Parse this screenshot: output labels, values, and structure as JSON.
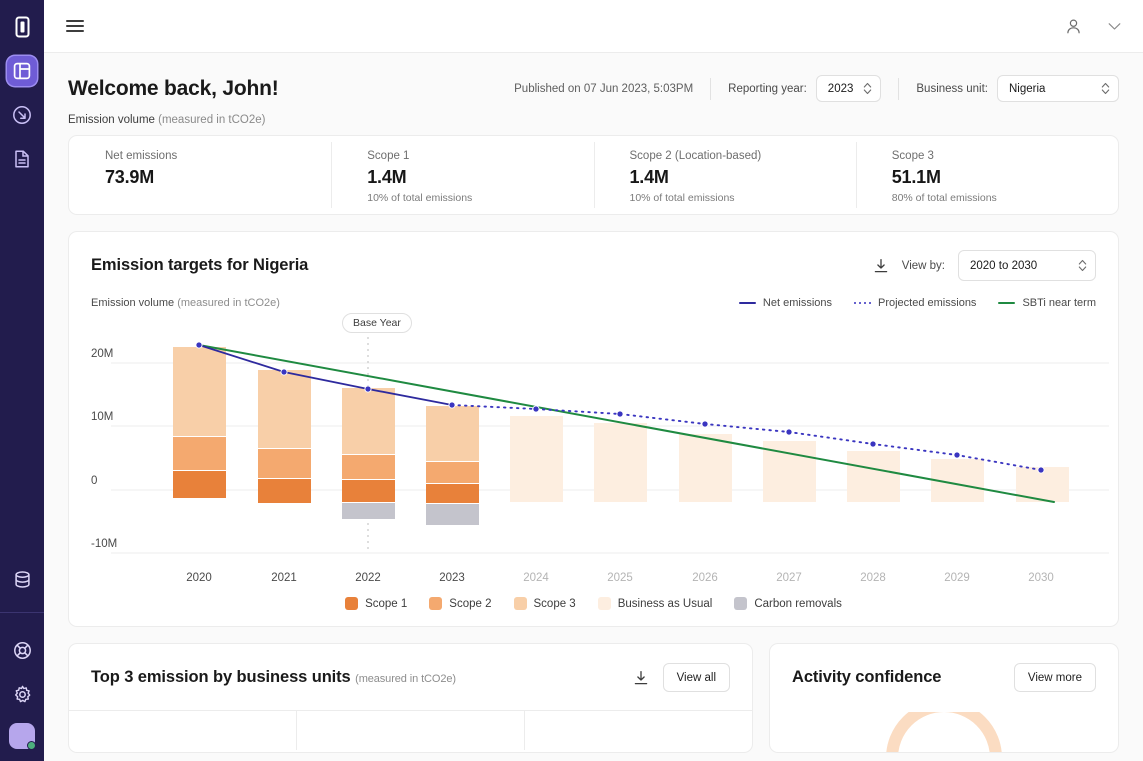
{
  "sidebar": {
    "items": [
      {
        "name": "logo-icon",
        "label": "Logo"
      },
      {
        "name": "dashboard-icon",
        "label": "Dashboard",
        "active": true
      },
      {
        "name": "data-import-icon",
        "label": "Data import"
      },
      {
        "name": "reports-icon",
        "label": "Reports"
      },
      {
        "name": "database-icon",
        "label": "Database"
      },
      {
        "name": "help-icon",
        "label": "Help"
      },
      {
        "name": "settings-icon",
        "label": "Settings"
      }
    ],
    "avatar": {
      "name": "avatar",
      "status": "online"
    }
  },
  "topbar": {
    "menu_icon": "hamburger-icon",
    "account_icon": "user-icon",
    "chevron_icon": "chevron-down-icon"
  },
  "header": {
    "title": "Welcome back, John!",
    "published": "Published on 07 Jun 2023, 5:03PM",
    "reporting_year_label": "Reporting year:",
    "reporting_year_value": "2023",
    "business_unit_label": "Business unit:",
    "business_unit_value": "Nigeria"
  },
  "emission_caption": {
    "strong": "Emission volume",
    "muted": "(measured in tCO2e)"
  },
  "kpis": [
    {
      "label": "Net emissions",
      "value": "73.9M",
      "sub": ""
    },
    {
      "label": "Scope 1",
      "value": "1.4M",
      "sub": "10% of total emissions"
    },
    {
      "label": "Scope 2 (Location-based)",
      "value": "1.4M",
      "sub": "10% of total emissions"
    },
    {
      "label": "Scope 3",
      "value": "51.1M",
      "sub": "80% of total emissions"
    }
  ],
  "chart_card": {
    "title": "Emission targets for Nigeria",
    "download_icon": "download-icon",
    "view_by_label": "View by:",
    "view_by_value": "2020 to 2030",
    "subtitle_strong": "Emission volume",
    "subtitle_muted": "(measured in tCO2e)",
    "base_year_badge": "Base Year"
  },
  "bottom": {
    "left": {
      "title": "Top 3 emission by business units",
      "title_muted": "(measured in tCO2e)",
      "download_icon": "download-icon",
      "view_all_label": "View all"
    },
    "right": {
      "title": "Activity confidence",
      "view_more_label": "View more"
    }
  },
  "colors": {
    "scope1": "#e8813a",
    "scope2": "#f4a96f",
    "scope3": "#f8cfa8",
    "bau": "#fdeee0",
    "carbon_removals": "#c4c4cc",
    "net_emissions_line": "#2e2a9e",
    "projected_line": "#3a35c0",
    "sbti_line": "#1f8a41",
    "brand_purple": "#6f5cd6",
    "sidebar_bg": "#221c4d"
  },
  "chart_data": {
    "type": "bar",
    "title": "Emission targets for Nigeria",
    "subtitle": "Emission volume (measured in tCO2e)",
    "xlabel": "",
    "ylabel": "Emission volume (tCO2e)",
    "ylim": [
      -12000000,
      23000000
    ],
    "yticks": [
      20000000,
      10000000,
      0,
      -10000000
    ],
    "ytick_labels": [
      "20M",
      "10M",
      "0",
      "-10M"
    ],
    "grid": true,
    "legend_position": "bottom",
    "categories": [
      "2020",
      "2021",
      "2022",
      "2023",
      "2024",
      "2025",
      "2026",
      "2027",
      "2028",
      "2029",
      "2030"
    ],
    "actual_years": [
      "2020",
      "2021",
      "2022",
      "2023"
    ],
    "projected_years": [
      "2024",
      "2025",
      "2026",
      "2027",
      "2028",
      "2029",
      "2030"
    ],
    "base_year": "2022",
    "stacked_series": [
      {
        "name": "Scope 1",
        "color": "#e8813a",
        "values": [
          4200000,
          3700000,
          2700000,
          2500000,
          null,
          null,
          null,
          null,
          null,
          null,
          null
        ]
      },
      {
        "name": "Scope 2",
        "color": "#f4a96f",
        "values": [
          3000000,
          2700000,
          2000000,
          1900000,
          null,
          null,
          null,
          null,
          null,
          null,
          null
        ]
      },
      {
        "name": "Scope 3",
        "color": "#f8cfa8",
        "values": [
          14000000,
          12500000,
          11000000,
          9400000,
          null,
          null,
          null,
          null,
          null,
          null,
          null
        ]
      },
      {
        "name": "Carbon removals",
        "color": "#c4c4cc",
        "values": [
          0,
          0,
          -2300000,
          -3000000,
          null,
          null,
          null,
          null,
          null,
          null,
          null
        ]
      }
    ],
    "bau_series": {
      "name": "Business as Usual",
      "color": "#fdeee0",
      "values": [
        null,
        null,
        null,
        null,
        13000000,
        12000000,
        10300000,
        9200000,
        7700000,
        6500000,
        5200000
      ]
    },
    "lines": [
      {
        "name": "Net emissions",
        "color": "#2e2a9e",
        "style": "solid",
        "markers": true,
        "x": [
          "2020",
          "2021",
          "2022",
          "2023"
        ],
        "values": [
          21200000,
          18100000,
          15300000,
          12900000
        ]
      },
      {
        "name": "Projected emissions",
        "color": "#3a35c0",
        "style": "dotted",
        "markers": true,
        "x": [
          "2023",
          "2024",
          "2025",
          "2026",
          "2027",
          "2028",
          "2029",
          "2030"
        ],
        "values": [
          12900000,
          12700000,
          12000000,
          10800000,
          9800000,
          8400000,
          7100000,
          5500000
        ]
      },
      {
        "name": "SBTi near term",
        "color": "#1f8a41",
        "style": "solid",
        "markers": false,
        "x": [
          "2020",
          "2030"
        ],
        "values": [
          21300000,
          4400000
        ]
      }
    ],
    "bar_legend": [
      {
        "label": "Scope 1",
        "color": "#e8813a"
      },
      {
        "label": "Scope 2",
        "color": "#f4a96f"
      },
      {
        "label": "Scope 3",
        "color": "#f8cfa8"
      },
      {
        "label": "Business as Usual",
        "color": "#fdeee0"
      },
      {
        "label": "Carbon removals",
        "color": "#c4c4cc"
      }
    ],
    "line_legend": [
      {
        "label": "Net emissions",
        "color": "#2e2a9e",
        "style": "solid"
      },
      {
        "label": "Projected emissions",
        "color": "#3a35c0",
        "style": "dotted"
      },
      {
        "label": "SBTi near term",
        "color": "#1f8a41",
        "style": "solid"
      }
    ]
  }
}
